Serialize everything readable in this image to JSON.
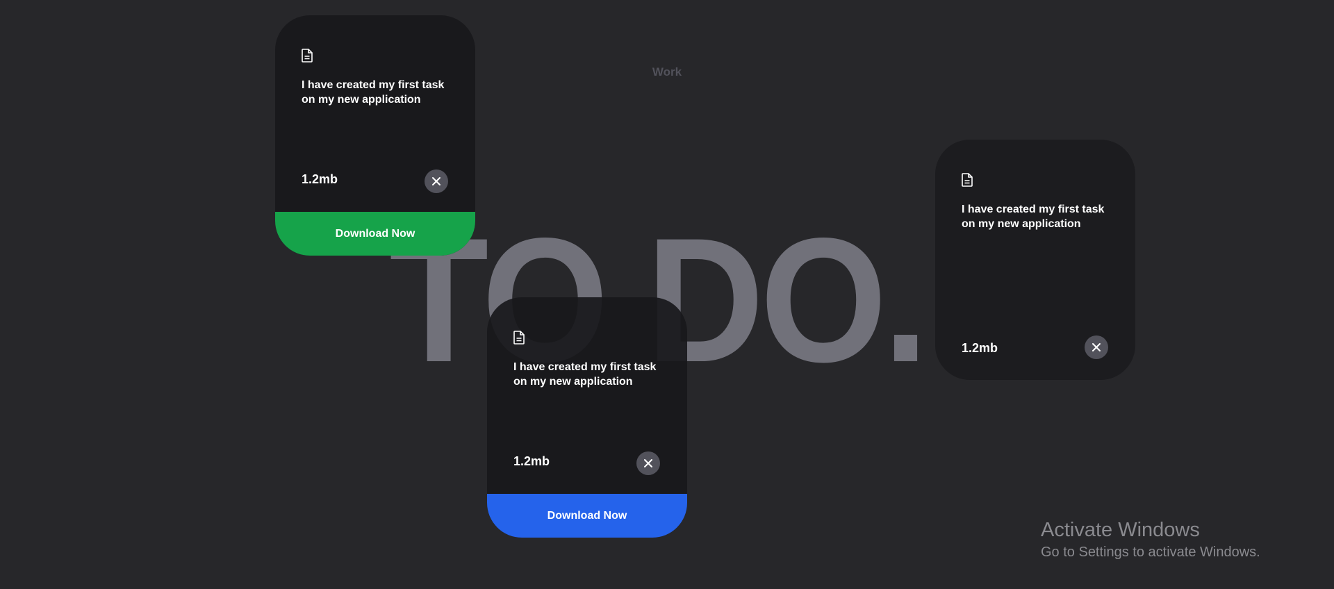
{
  "page": {
    "category": "Work",
    "background_title": "TO DO.",
    "background_color": "#27272a"
  },
  "cards": [
    {
      "icon": "document-icon",
      "description": "I have created my first task on my new application",
      "file_size": "1.2mb",
      "close_icon": "close-icon",
      "download_label": "Download Now",
      "download_color": "#16a34a"
    },
    {
      "icon": "document-icon",
      "description": "I have created my first task on my new application",
      "file_size": "1.2mb",
      "close_icon": "close-icon",
      "download_label": "Download Now",
      "download_color": "#2563eb"
    },
    {
      "icon": "document-icon",
      "description": "I have created my first task on my new application",
      "file_size": "1.2mb",
      "close_icon": "close-icon"
    }
  ],
  "watermark": {
    "title": "Activate Windows",
    "subtitle": "Go to Settings to activate Windows."
  }
}
